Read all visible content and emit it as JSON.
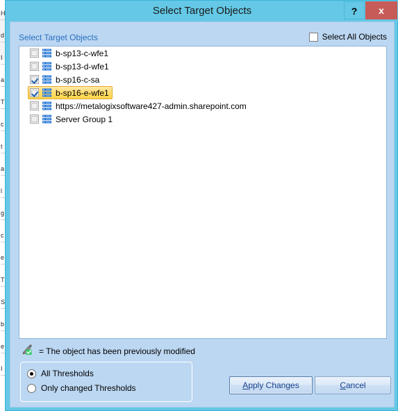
{
  "window": {
    "title": "Select Target Objects",
    "help_button": "?",
    "close_button": "x",
    "titlebar_color": "#64c8e6",
    "close_button_color": "#c75b57",
    "body_color": "#bcd7f2"
  },
  "panel": {
    "group_label": "Select Target Objects",
    "select_all": {
      "label": "Select All Objects",
      "checked": false
    }
  },
  "list": {
    "items": [
      {
        "label": "b-sp13-c-wfe1",
        "checked": false,
        "selected": false,
        "icon": "server-icon"
      },
      {
        "label": "b-sp13-d-wfe1",
        "checked": false,
        "selected": false,
        "icon": "server-icon"
      },
      {
        "label": "b-sp16-c-sa",
        "checked": true,
        "selected": false,
        "icon": "server-icon"
      },
      {
        "label": "b-sp16-e-wfe1",
        "checked": true,
        "selected": true,
        "icon": "server-icon"
      },
      {
        "label": "https://metalogixsoftware427-admin.sharepoint.com",
        "checked": false,
        "selected": false,
        "icon": "server-icon"
      },
      {
        "label": "Server Group 1",
        "checked": false,
        "selected": false,
        "icon": "server-icon"
      }
    ],
    "selection_highlight_color": "#ffd84a"
  },
  "legend": {
    "icon": "pencil-modified-icon",
    "text": "= The object has been previously modified"
  },
  "thresholds": {
    "options": [
      {
        "label": "All Thresholds",
        "selected": true
      },
      {
        "label": "Only changed Thresholds",
        "selected": false
      }
    ]
  },
  "actions": {
    "apply": {
      "accel": "A",
      "rest": "pply Changes"
    },
    "cancel": {
      "accel": "C",
      "rest": "ancel"
    }
  },
  "background_window": {
    "lines": [
      "H",
      "d",
      "I",
      "a",
      "T",
      "c",
      "t",
      "a",
      "l",
      "g",
      "c",
      "e",
      "T",
      "S",
      "b",
      "e",
      "I"
    ]
  }
}
